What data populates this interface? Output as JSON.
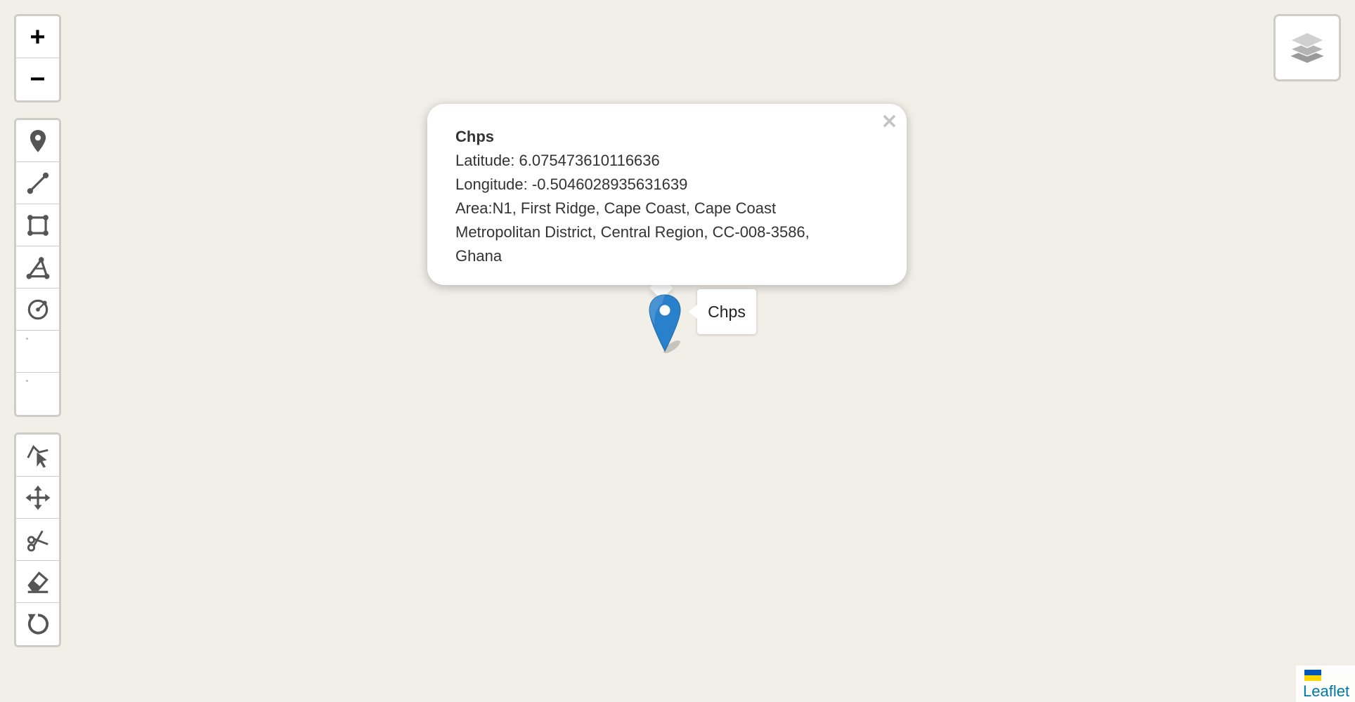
{
  "zoom": {
    "in_label": "+",
    "out_label": "−"
  },
  "draw_tools": {
    "icons": [
      "marker-icon",
      "polyline-icon",
      "rectangle-icon",
      "polygon-icon",
      "circle-icon",
      "blank-tool-icon",
      "blank-tool-icon"
    ]
  },
  "edit_tools": {
    "icons": [
      "drag-select-icon",
      "move-icon",
      "cut-icon",
      "eraser-icon",
      "rotate-icon"
    ]
  },
  "layers": {
    "icon": "layers-icon"
  },
  "popup": {
    "title": "Chps",
    "lines": [
      "Latitude: 6.075473610116636",
      "Longitude: -0.5046028935631639",
      "Area:N1, First Ridge, Cape Coast, Cape Coast",
      "Metropolitan District, Central Region, CC-008-3586,",
      "Ghana"
    ],
    "close_label": "×"
  },
  "marker": {
    "tooltip": "Chps",
    "color": "#2a81cb"
  },
  "attribution": {
    "link_label": "Leaflet",
    "flag_colors": [
      "#0057b7",
      "#ffd700"
    ]
  }
}
